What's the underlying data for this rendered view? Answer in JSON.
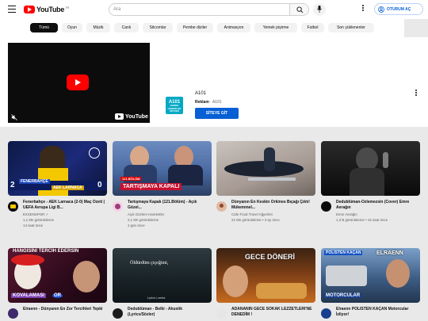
{
  "header": {
    "logo_text": "YouTube",
    "logo_country": "TR",
    "search_placeholder": "Ara",
    "signin_label": "OTURUM AÇ"
  },
  "chips": [
    {
      "label": "Tümü",
      "active": true
    },
    {
      "label": "Oyun"
    },
    {
      "label": "Müzik"
    },
    {
      "label": "Canlı"
    },
    {
      "label": "Sitcomlar"
    },
    {
      "label": "Pembe diziler"
    },
    {
      "label": "Animasyon"
    },
    {
      "label": "Yemek pişirme"
    },
    {
      "label": "Futbol"
    },
    {
      "label": "Son yüklenenler"
    }
  ],
  "ad": {
    "watermark": "YouTube",
    "logo_top": "A101",
    "logo_line1": "HADDE",
    "logo_line2": "HABERLER",
    "logo_line3": "İMYVEN",
    "title": "A101",
    "badge": "Reklam",
    "advertiser": "· A101",
    "cta": "SİTEYE GİT"
  },
  "videos": [
    {
      "title": "Fenerbahçe - AEK Larnaca (2-0) Maç Özeti | UEFA Avrupa Ligi B...",
      "channel": "EXXENSPOR ✓",
      "views": "1,1 Mn görüntüleme",
      "age": "14 saat önce",
      "overlay_left": "2",
      "overlay_mid": "FENERBAHÇE",
      "overlay_mid2": "AEK LARNACA",
      "overlay_right": "0"
    },
    {
      "title": "Tartışmaya Kapalı (121.Bölüm) - Açık Gözel...",
      "channel": "Açık Gözlem Hareketler",
      "views": "2,1 Mn görüntüleme",
      "age": "4 gün önce",
      "overlay_ep": "121.BÖLÜM",
      "overlay_main": "TARTIŞMAYA KAPALI"
    },
    {
      "title": "Dünyanın En Keskin Orkinos Bıçağı Çıktı! Mükemmel...",
      "channel": "Cafe Food Travel Ağyerleri",
      "views": "21 Mn görüntüleme",
      "age": "3 ay önce"
    },
    {
      "title": "Dedublüman-Özlemezsin (Cover) Emre Aerağın",
      "channel": "Emre Aerağın",
      "views": "1,3 B görüntüleme",
      "age": "16 saat önce"
    },
    {
      "title": "Elraenn - Dünyanın En Zor Tercihleri Tepki",
      "channel": "",
      "views": "",
      "age": "",
      "overlay_top": "HANGİSİNİ TERCİH EDERSİN",
      "overlay_bottom": "KOVALAMASI",
      "overlay_or": "OR"
    },
    {
      "title": "Dedublüman - Belki - Akustik (Lyrics/Sözler)",
      "channel": "",
      "views": "",
      "age": "",
      "overlay_main": "Öldürdüm çiçeğimi,",
      "overlay_sub": "Lyrics Lamia"
    },
    {
      "title": "ADANANIN GECE SOKAK LEZZETLERİ'NE DENEDİM !",
      "channel": "",
      "views": "",
      "age": "",
      "overlay_main": "GECE DÖNERİ"
    },
    {
      "title": "Elraenn POLİSTEN KAÇAN Motorcular İzliyor!",
      "channel": "",
      "views": "",
      "age": "",
      "overlay_top": "POLİSTEN KAÇAN",
      "overlay_right": "ELRAENN",
      "overlay_bottom": "MOTORCULAR"
    }
  ]
}
